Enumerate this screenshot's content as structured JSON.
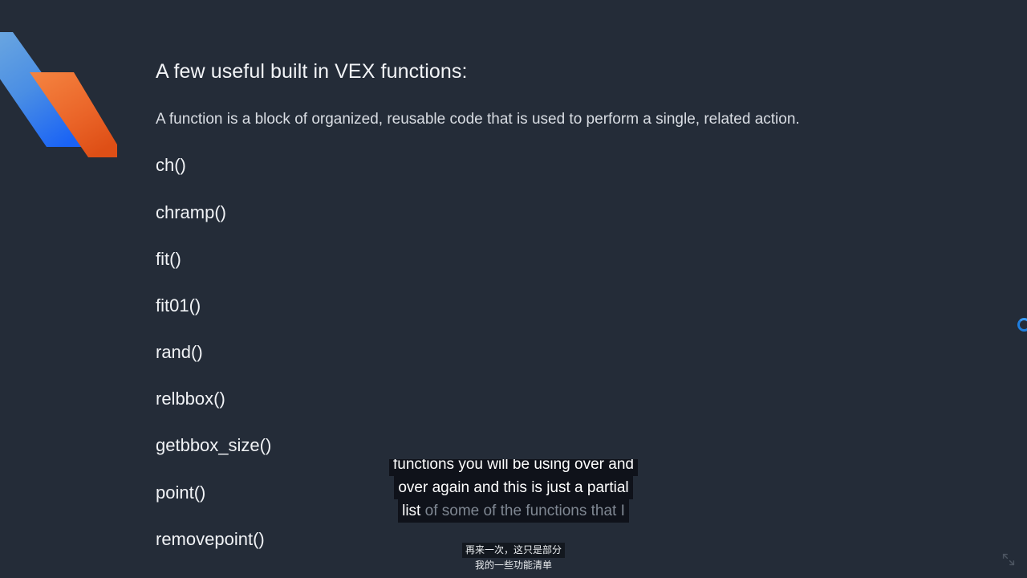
{
  "slide": {
    "background_color": "#242c38",
    "logo": {
      "name": "sidefx-houdini-logo",
      "blue_light": "#6aa7dd",
      "blue_deep": "#1a63f0",
      "orange_light": "#f1793c",
      "orange_deep": "#e2531a"
    },
    "title": "A few useful built in VEX functions:",
    "subtitle": "A function is a block of organized, reusable code that is used to perform a single, related action.",
    "functions": [
      "ch()",
      "chramp()",
      "fit()",
      "fit01()",
      "rand()",
      "relbbox()",
      "getbbox_size()",
      "point()",
      "removepoint()"
    ]
  },
  "caption": {
    "line1": "functions you will be using over and",
    "line2": "over again and this is just a partial",
    "line3_spoken": "list",
    "line3_pending": " of some of the functions that I"
  },
  "chinese_subtitles": {
    "line1": "再来一次，这只是部分",
    "line2": "我的一些功能清单"
  },
  "overlays": {
    "edge_ring_color": "#1f7fe0",
    "fullscreen_icon": "expand-arrows"
  }
}
